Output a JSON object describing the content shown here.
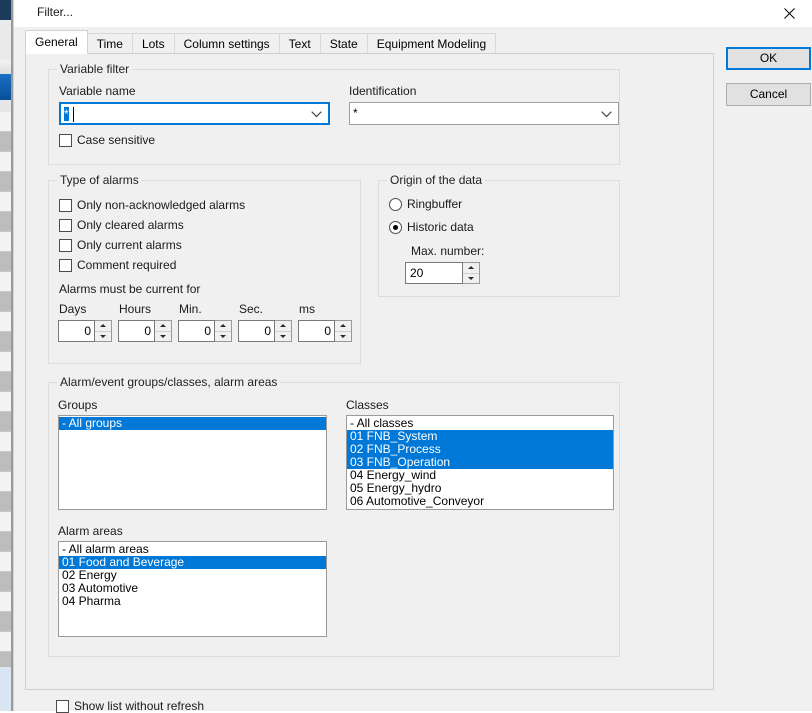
{
  "window": {
    "title": "Filter...",
    "close_icon": "close-icon"
  },
  "tabs": [
    {
      "label": "General",
      "active": true
    },
    {
      "label": "Time",
      "active": false
    },
    {
      "label": "Lots",
      "active": false
    },
    {
      "label": "Column settings",
      "active": false
    },
    {
      "label": "Text",
      "active": false
    },
    {
      "label": "State",
      "active": false
    },
    {
      "label": "Equipment Modeling",
      "active": false
    }
  ],
  "variable_filter": {
    "legend": "Variable filter",
    "variable_name": {
      "label": "Variable name",
      "value": "*",
      "selected": true
    },
    "identification": {
      "label": "Identification",
      "value": "*",
      "selected": false
    },
    "case_sensitive": {
      "label": "Case sensitive",
      "checked": false
    }
  },
  "type_of_alarms": {
    "legend": "Type of alarms",
    "checkboxes": [
      {
        "label": "Only non-acknowledged alarms",
        "checked": false
      },
      {
        "label": "Only cleared alarms",
        "checked": false
      },
      {
        "label": "Only current alarms",
        "checked": false
      },
      {
        "label": "Comment required",
        "checked": false
      }
    ],
    "duration_label": "Alarms must be current for",
    "duration_fields": [
      {
        "label": "Days",
        "value": "0"
      },
      {
        "label": "Hours",
        "value": "0"
      },
      {
        "label": "Min.",
        "value": "0"
      },
      {
        "label": "Sec.",
        "value": "0"
      },
      {
        "label": "ms",
        "value": "0"
      }
    ]
  },
  "origin_of_data": {
    "legend": "Origin of the data",
    "options": [
      {
        "label": "Ringbuffer",
        "checked": false
      },
      {
        "label": "Historic data",
        "checked": true
      }
    ],
    "max_number": {
      "label": "Max. number:",
      "value": "20"
    }
  },
  "groups_classes_areas": {
    "legend": "Alarm/event groups/classes, alarm areas",
    "groups": {
      "label": "Groups",
      "items": [
        {
          "text": "- All groups",
          "selected": true
        }
      ]
    },
    "classes": {
      "label": "Classes",
      "items": [
        {
          "text": "- All classes",
          "selected": false
        },
        {
          "text": "01 FNB_System",
          "selected": true
        },
        {
          "text": "02 FNB_Process",
          "selected": true
        },
        {
          "text": "03 FNB_Operation",
          "selected": true
        },
        {
          "text": "04 Energy_wind",
          "selected": false
        },
        {
          "text": "05 Energy_hydro",
          "selected": false
        },
        {
          "text": "06 Automotive_Conveyor",
          "selected": false
        }
      ]
    },
    "alarm_areas": {
      "label": "Alarm areas",
      "items": [
        {
          "text": "- All alarm areas",
          "selected": false
        },
        {
          "text": "01 Food and Beverage",
          "selected": true
        },
        {
          "text": "02 Energy",
          "selected": false
        },
        {
          "text": "03 Automotive",
          "selected": false
        },
        {
          "text": "04 Pharma",
          "selected": false
        }
      ]
    }
  },
  "show_list_without_refresh": {
    "label": "Show list without refresh",
    "checked": false
  },
  "buttons": {
    "ok": "OK",
    "cancel": "Cancel"
  },
  "colors": {
    "selection_blue": "#0078d7",
    "dialog_face": "#f0f0f0",
    "titlebar_bg": "#ffffff"
  }
}
